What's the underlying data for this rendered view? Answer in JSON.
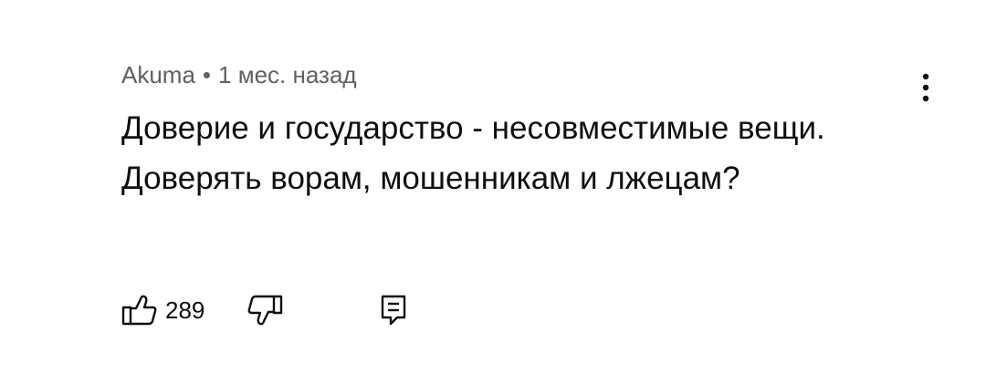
{
  "comment": {
    "author": "Akuma",
    "separator": "•",
    "time": "1 мес. назад",
    "text": "Доверие и государство - несовместимые вещи. Доверять ворам, мошенникам и лжецам?",
    "like_count": "289"
  },
  "icons": {
    "menu": "more-vert-icon",
    "like": "thumb-up-icon",
    "dislike": "thumb-down-icon",
    "reply": "comment-icon"
  },
  "colors": {
    "meta_text": "#606060",
    "body_text": "#0f0f0f",
    "background": "#ffffff"
  }
}
